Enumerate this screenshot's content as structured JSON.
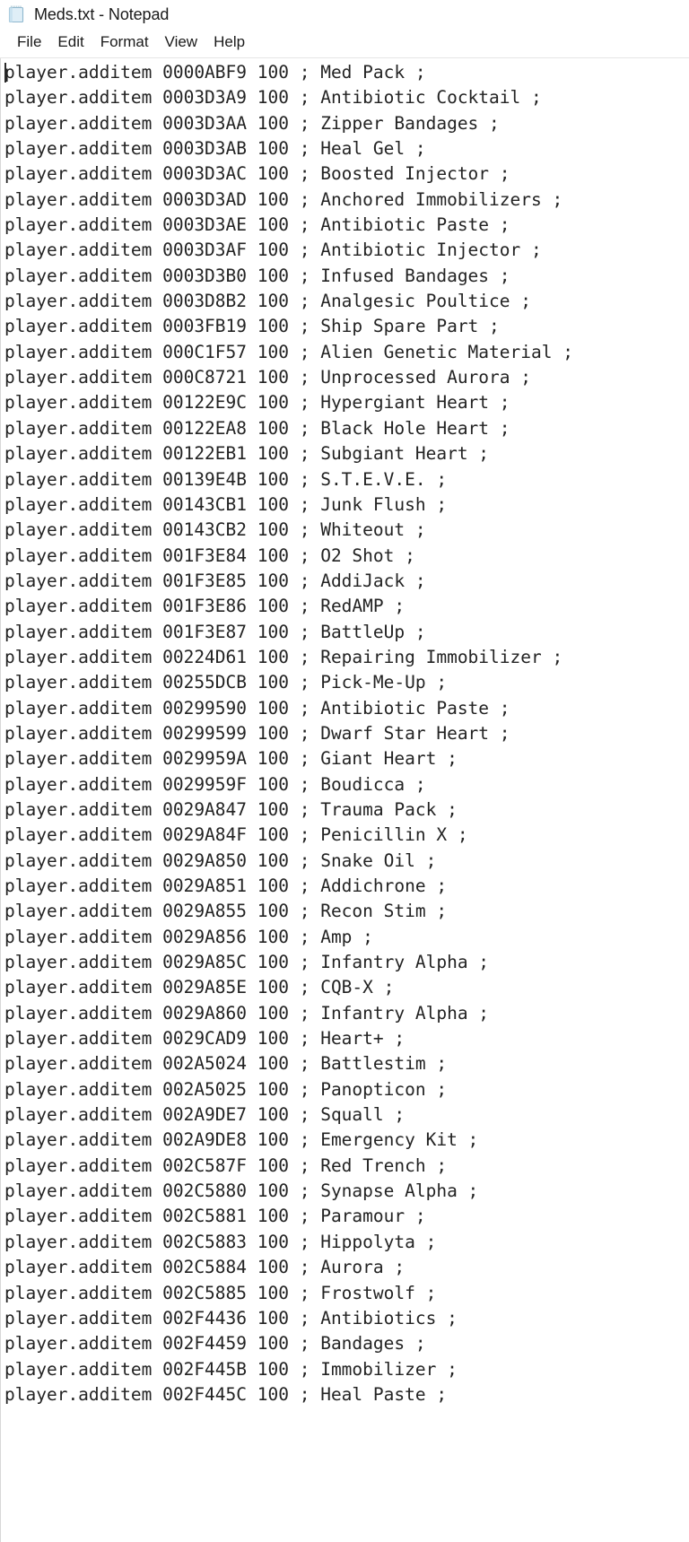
{
  "window": {
    "title": "Meds.txt - Notepad",
    "icon": "notepad-icon"
  },
  "menubar": {
    "items": [
      {
        "label": "File"
      },
      {
        "label": "Edit"
      },
      {
        "label": "Format"
      },
      {
        "label": "View"
      },
      {
        "label": "Help"
      }
    ]
  },
  "editor": {
    "caret_visible": true,
    "lines": [
      "player.additem 0000ABF9 100 ; Med Pack ;",
      "player.additem 0003D3A9 100 ; Antibiotic Cocktail ;",
      "player.additem 0003D3AA 100 ; Zipper Bandages ;",
      "player.additem 0003D3AB 100 ; Heal Gel ;",
      "player.additem 0003D3AC 100 ; Boosted Injector ;",
      "player.additem 0003D3AD 100 ; Anchored Immobilizers ;",
      "player.additem 0003D3AE 100 ; Antibiotic Paste ;",
      "player.additem 0003D3AF 100 ; Antibiotic Injector ;",
      "player.additem 0003D3B0 100 ; Infused Bandages ;",
      "player.additem 0003D8B2 100 ; Analgesic Poultice ;",
      "player.additem 0003FB19 100 ; Ship Spare Part ;",
      "player.additem 000C1F57 100 ; Alien Genetic Material ;",
      "player.additem 000C8721 100 ; Unprocessed Aurora ;",
      "player.additem 00122E9C 100 ; Hypergiant Heart ;",
      "player.additem 00122EA8 100 ; Black Hole Heart ;",
      "player.additem 00122EB1 100 ; Subgiant Heart ;",
      "player.additem 00139E4B 100 ; S.T.E.V.E. ;",
      "player.additem 00143CB1 100 ; Junk Flush ;",
      "player.additem 00143CB2 100 ; Whiteout ;",
      "player.additem 001F3E84 100 ; O2 Shot ;",
      "player.additem 001F3E85 100 ; AddiJack ;",
      "player.additem 001F3E86 100 ; RedAMP ;",
      "player.additem 001F3E87 100 ; BattleUp ;",
      "player.additem 00224D61 100 ; Repairing Immobilizer ;",
      "player.additem 00255DCB 100 ; Pick-Me-Up ;",
      "player.additem 00299590 100 ; Antibiotic Paste ;",
      "player.additem 00299599 100 ; Dwarf Star Heart ;",
      "player.additem 0029959A 100 ; Giant Heart ;",
      "player.additem 0029959F 100 ; Boudicca ;",
      "player.additem 0029A847 100 ; Trauma Pack ;",
      "player.additem 0029A84F 100 ; Penicillin X ;",
      "player.additem 0029A850 100 ; Snake Oil ;",
      "player.additem 0029A851 100 ; Addichrone ;",
      "player.additem 0029A855 100 ; Recon Stim ;",
      "player.additem 0029A856 100 ; Amp ;",
      "player.additem 0029A85C 100 ; Infantry Alpha ;",
      "player.additem 0029A85E 100 ; CQB-X ;",
      "player.additem 0029A860 100 ; Infantry Alpha ;",
      "player.additem 0029CAD9 100 ; Heart+ ;",
      "player.additem 002A5024 100 ; Battlestim ;",
      "player.additem 002A5025 100 ; Panopticon ;",
      "player.additem 002A9DE7 100 ; Squall ;",
      "player.additem 002A9DE8 100 ; Emergency Kit ;",
      "player.additem 002C587F 100 ; Red Trench ;",
      "player.additem 002C5880 100 ; Synapse Alpha ;",
      "player.additem 002C5881 100 ; Paramour ;",
      "player.additem 002C5883 100 ; Hippolyta ;",
      "player.additem 002C5884 100 ; Aurora ;",
      "player.additem 002C5885 100 ; Frostwolf ;",
      "player.additem 002F4436 100 ; Antibiotics ;",
      "player.additem 002F4459 100 ; Bandages ;",
      "player.additem 002F445B 100 ; Immobilizer ;",
      "player.additem 002F445C 100 ; Heal Paste ;"
    ]
  },
  "colors": {
    "background": "#ffffff",
    "text": "#232323",
    "title_text": "#1a1a1a",
    "icon_paper": "#dcebf5",
    "icon_outline": "#8fb8cf"
  }
}
